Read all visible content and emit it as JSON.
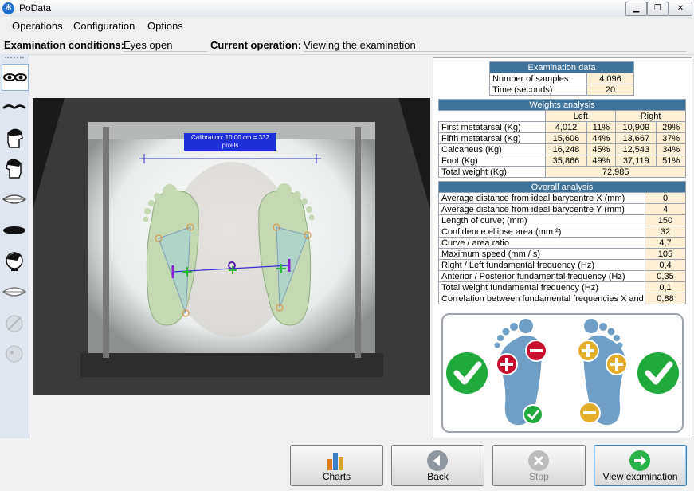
{
  "window": {
    "title": "PoData",
    "minimize_icon": "minimize-icon",
    "restore_icon": "restore-icon",
    "close_icon": "close-icon"
  },
  "menu": {
    "items": [
      "Operations",
      "Configuration",
      "Options"
    ]
  },
  "status": {
    "conditions_label": "Examination conditions:",
    "conditions_value": "Eyes open",
    "operation_label": "Current operation:",
    "operation_value": "Viewing the examination"
  },
  "camera": {
    "calibration_line1": "Calibration: 10,00 cm = 332",
    "calibration_line2": "pixels"
  },
  "exam_data": {
    "title": "Examination data",
    "rows": [
      {
        "label": "Number of samples",
        "value": "4.096"
      },
      {
        "label": "Time (seconds)",
        "value": "20"
      }
    ]
  },
  "weights": {
    "title": "Weights analysis",
    "left_header": "Left",
    "right_header": "Right",
    "rows": [
      {
        "label": "First metatarsal (Kg)",
        "lv": "4,012",
        "lp": "11%",
        "rv": "10,909",
        "rp": "29%"
      },
      {
        "label": "Fifth metatarsal (Kg)",
        "lv": "15,606",
        "lp": "44%",
        "rv": "13,667",
        "rp": "37%"
      },
      {
        "label": "Calcaneus (Kg)",
        "lv": "16,248",
        "lp": "45%",
        "rv": "12,543",
        "rp": "34%"
      },
      {
        "label": "Foot (Kg)",
        "lv": "35,866",
        "lp": "49%",
        "rv": "37,119",
        "rp": "51%"
      }
    ],
    "total_label": "Total weight (Kg)",
    "total_value": "72,985"
  },
  "overall": {
    "title": "Overall analysis",
    "rows": [
      {
        "label": "Average distance from ideal barycentre X (mm)",
        "value": "0"
      },
      {
        "label": "Average distance from ideal barycentre Y (mm)",
        "value": "4"
      },
      {
        "label": "Length of curve; (mm)",
        "value": "150"
      },
      {
        "label": "Confidence ellipse area (mm ²)",
        "value": "32"
      },
      {
        "label": "Curve / area ratio",
        "value": "4,7"
      },
      {
        "label": "Maximum speed (mm / s)",
        "value": "105"
      },
      {
        "label": "Right / Left  fundamental frequency (Hz)",
        "value": "0,4"
      },
      {
        "label": "Anterior / Posterior fundamental frequency (Hz)",
        "value": "0,35"
      },
      {
        "label": "Total weight fundamental frequency (Hz)",
        "value": "0,1"
      },
      {
        "label": "Correlation between fundamental frequencies X and",
        "value": "0,88"
      }
    ]
  },
  "buttons": {
    "charts": "Charts",
    "back": "Back",
    "stop": "Stop",
    "view": "View examination"
  },
  "colors": {
    "header_blue": "#3f7399",
    "cell_cream": "#fdf0d6",
    "foot_blue": "#6f9fc6",
    "ok_green": "#1faa3b",
    "minus_red": "#c8102e",
    "plus_gold": "#e3ad2a"
  },
  "left_tools": [
    "eyes-open-icon",
    "eyes-closed-icon",
    "head-right-icon",
    "head-left-icon",
    "mouth-open-icon",
    "mouth-closed-icon",
    "head-tilt-icon",
    "mouth-icon",
    "dim-head-icon",
    "dim-head-2-icon"
  ]
}
